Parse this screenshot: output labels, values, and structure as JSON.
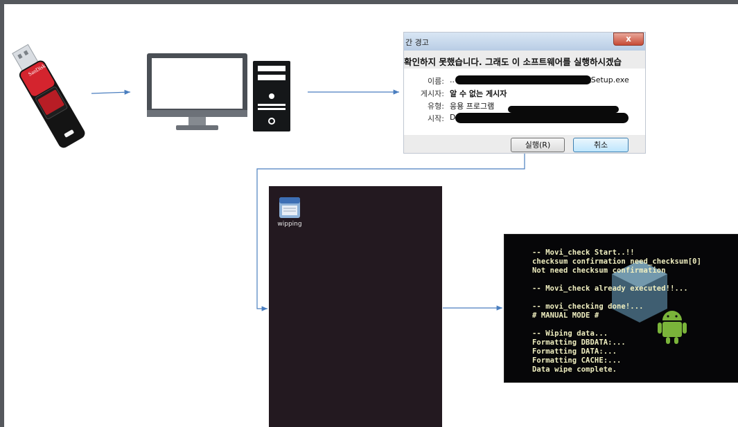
{
  "dialog": {
    "title": "간 경고",
    "close": "x",
    "headline": "확인하지 못했습니다.  그래도 이 소프트웨어를 실행하시겠습",
    "fields": [
      {
        "label": "이름:",
        "value": "..",
        "tail": "\\Setup.exe"
      },
      {
        "label": "게시자:",
        "value": "알 수 없는 게시자"
      },
      {
        "label": "유형:",
        "value": "응용 프로그램"
      },
      {
        "label": "시작:",
        "value": "D"
      }
    ],
    "run_button": "실행(R)",
    "cancel_button": "취소"
  },
  "desktop": {
    "icon_label": "wipping"
  },
  "terminal": {
    "lines": [
      "-- Movi_check Start..!!",
      "checksum confirmation need_checksum[0]",
      "Not need checksum confirmation",
      "",
      "-- Movi_check already executed!!...",
      "",
      "-- movi_checking done!...",
      "   # MANUAL MODE #",
      "",
      "-- Wiping data...",
      "Formatting DBDATA:...",
      "Formatting DATA:...",
      "Formatting CACHE:...",
      "Data wipe complete."
    ]
  },
  "usb": {
    "brand": "SanDisk"
  },
  "colors": {
    "arrow": "#4a7ebf",
    "frame": "#55585d",
    "desktop_bg": "#231920",
    "terminal_text": "#f0efc0",
    "usb_red": "#d4242e"
  }
}
